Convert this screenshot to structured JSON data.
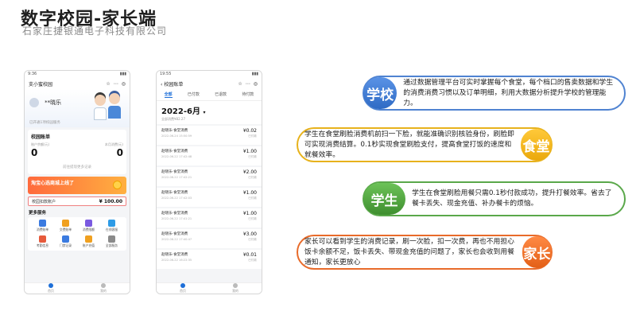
{
  "header": {
    "title": "数字校园-家长端",
    "subtitle": "石家庄捷银通电子科技有限公司"
  },
  "phone1": {
    "status_time": "9:36",
    "app_title": "支小蜜校园",
    "user_name": "**晓乐",
    "bind_text": "已开通1项校园服务",
    "balance_card_title": "校园账单",
    "balance_left_label": "账户余额(元)",
    "balance_left_value": "0",
    "balance_right_label": "本月消费(元)",
    "balance_right_value": "0",
    "balance_link": "前往提现更多记录",
    "banner_text": "淘宝心选商城上线了",
    "account_label": "校园扣款账户",
    "account_value": "¥ 100.00",
    "services_title": "更多服务",
    "services": [
      {
        "label": "消费账单",
        "color": "#3b7be0"
      },
      {
        "label": "交费账单",
        "color": "#f0a020"
      },
      {
        "label": "消费限额",
        "color": "#7a5ae0"
      },
      {
        "label": "在线客服",
        "color": "#2e9be6"
      },
      {
        "label": "考勤信息",
        "color": "#e65a3b"
      },
      {
        "label": "门禁记录",
        "color": "#3b7be0"
      },
      {
        "label": "账户充值",
        "color": "#f0a020"
      },
      {
        "label": "全部服务",
        "color": "#8a8a8a"
      }
    ],
    "tabs": [
      "首页",
      "我的"
    ]
  },
  "phone2": {
    "status_time": "19:55",
    "page_title": "校园账单",
    "filters": [
      "全部",
      "已付款",
      "已退款",
      "待付款"
    ],
    "month": "2022-6月",
    "month_summary": "全部消费¥82.27",
    "transactions": [
      {
        "name": "赵晓乐-食堂消费",
        "time": "2022-06-24 15:50:59",
        "amount": "¥0.02",
        "status": "已付款"
      },
      {
        "name": "赵晓乐-食堂消费",
        "time": "2022-06-22 17:42:48",
        "amount": "¥1.00",
        "status": "已付款"
      },
      {
        "name": "赵晓乐-食堂消费",
        "time": "2022-06-22 17:42:21",
        "amount": "¥2.00",
        "status": "已付款"
      },
      {
        "name": "赵晓乐-食堂消费",
        "time": "2022-06-22 17:42:03",
        "amount": "¥1.00",
        "status": "已付款"
      },
      {
        "name": "赵晓乐-食堂消费",
        "time": "2022-06-22 17:41:21",
        "amount": "¥1.00",
        "status": "已付款"
      },
      {
        "name": "赵晓乐-食堂消费",
        "time": "2022-06-22 17:40:47",
        "amount": "¥3.00",
        "status": "已付款"
      },
      {
        "name": "赵晓乐-食堂消费",
        "time": "2022-06-22 16:22:35",
        "amount": "¥0.01",
        "status": "已付款"
      }
    ],
    "tabs": [
      "首页",
      "我的"
    ]
  },
  "capsules": {
    "school": {
      "label": "学校",
      "text": "通过数据管理平台可实时掌握每个食堂，每个档口的售卖数据和学生的消费消费习惯以及订单明细，利用大数据分析提升学校的管理能力。"
    },
    "canteen": {
      "label": "食堂",
      "text": "学生在食堂刷脸消费机前扫一下脸，就能准确识别核验身份，刷脸即可实现消费结算。0.1秒实现食堂刷脸支付，提高食堂打饭的速度和就餐效率。"
    },
    "student": {
      "label": "学生",
      "text": "学生在食堂刷脸用餐只需0.1秒付款成功，提升打餐效率。省去了餐卡丢失、现金充值、补办餐卡的烦恼。"
    },
    "parent": {
      "label": "家长",
      "text": "家长可以看到学生的消费记录，刷一次脸，扣一次费，再也不用担心饭卡余额不足，饭卡丢失、带现金充值的问题了，家长也会收到用餐通知，家长更放心"
    }
  }
}
